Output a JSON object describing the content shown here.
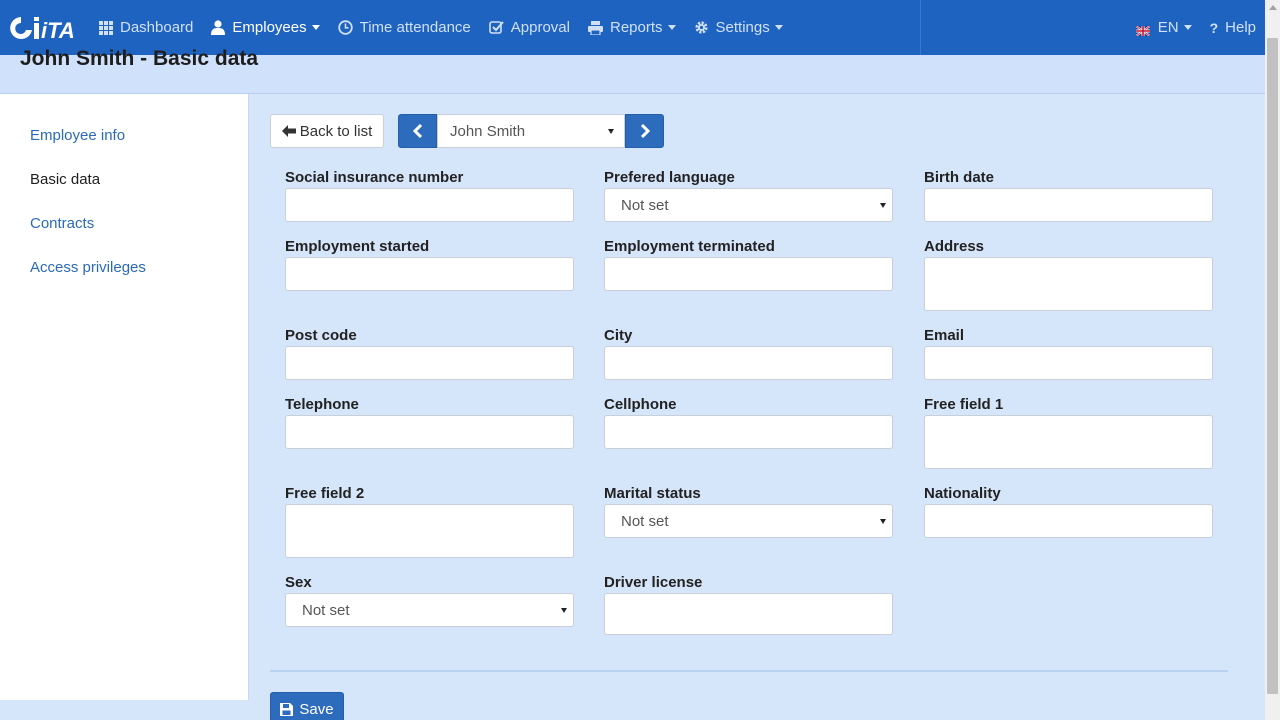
{
  "nav": {
    "logo_text": "iTA",
    "items": [
      {
        "label": "Dashboard",
        "icon": "grid-icon"
      },
      {
        "label": "Employees",
        "icon": "user-icon"
      },
      {
        "label": "Time attendance",
        "icon": "clock-icon"
      },
      {
        "label": "Approval",
        "icon": "check-square-icon"
      },
      {
        "label": "Reports",
        "icon": "print-icon"
      },
      {
        "label": "Settings",
        "icon": "gear-icon"
      }
    ],
    "language": "EN",
    "help": "Help"
  },
  "page": {
    "title": "John Smith - Basic data"
  },
  "sidebar": {
    "items": [
      {
        "label": "Employee info"
      },
      {
        "label": "Basic data"
      },
      {
        "label": "Contracts"
      },
      {
        "label": "Access privileges"
      }
    ]
  },
  "toolbar": {
    "back_label": "Back to list",
    "employee_selected": "John Smith"
  },
  "form": {
    "social_insurance_number": {
      "label": "Social insurance number",
      "value": ""
    },
    "prefered_language": {
      "label": "Prefered language",
      "value": "Not set"
    },
    "birth_date": {
      "label": "Birth date",
      "value": ""
    },
    "employment_started": {
      "label": "Employment started",
      "value": ""
    },
    "employment_terminated": {
      "label": "Employment terminated",
      "value": ""
    },
    "address": {
      "label": "Address",
      "value": ""
    },
    "post_code": {
      "label": "Post code",
      "value": ""
    },
    "city": {
      "label": "City",
      "value": ""
    },
    "email": {
      "label": "Email",
      "value": ""
    },
    "telephone": {
      "label": "Telephone",
      "value": ""
    },
    "cellphone": {
      "label": "Cellphone",
      "value": ""
    },
    "free_field_1": {
      "label": "Free field 1",
      "value": ""
    },
    "free_field_2": {
      "label": "Free field 2",
      "value": ""
    },
    "marital_status": {
      "label": "Marital status",
      "value": "Not set"
    },
    "nationality": {
      "label": "Nationality",
      "value": ""
    },
    "sex": {
      "label": "Sex",
      "value": "Not set"
    },
    "driver_license": {
      "label": "Driver license",
      "value": ""
    }
  },
  "actions": {
    "save_label": "Save"
  },
  "colors": {
    "primary": "#1f63c0",
    "background": "#d6e6fa",
    "link": "#2a6ab9"
  }
}
